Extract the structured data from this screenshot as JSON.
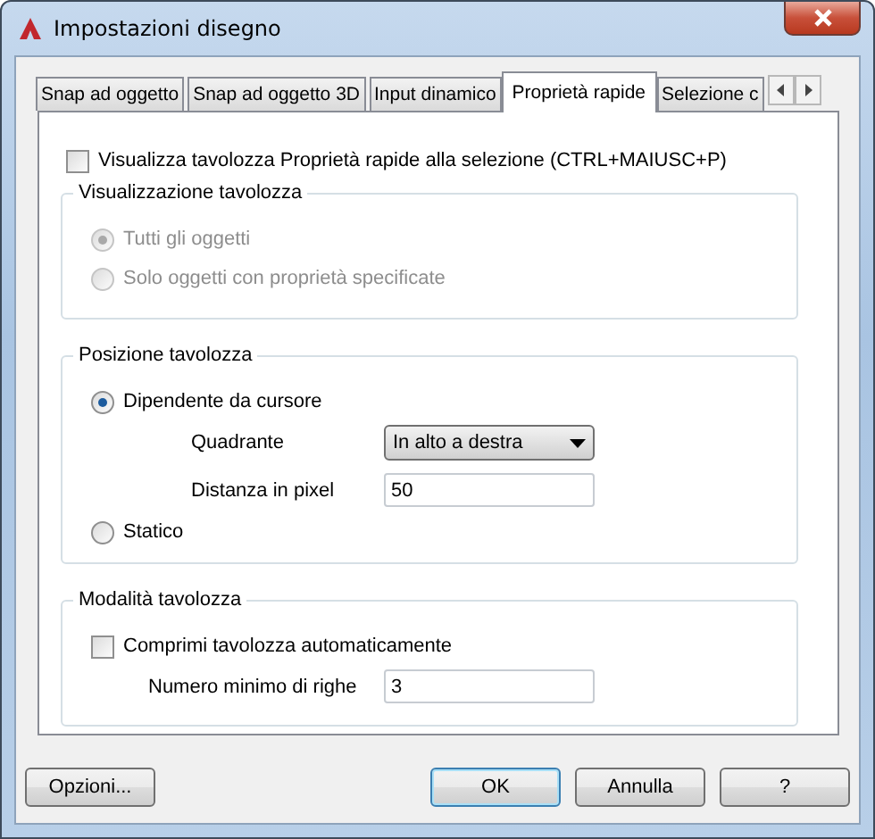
{
  "window": {
    "title": "Impostazioni disegno"
  },
  "tabs": [
    {
      "label": "Snap ad oggetto",
      "selected": false
    },
    {
      "label": "Snap ad oggetto 3D",
      "selected": false
    },
    {
      "label": "Input dinamico",
      "selected": false
    },
    {
      "label": "Proprietà rapide",
      "selected": true
    },
    {
      "label": "Selezione c",
      "selected": false
    }
  ],
  "show_palette": {
    "label": "Visualizza tavolozza Proprietà rapide alla selezione (CTRL+MAIUSC+P)",
    "checked": false
  },
  "display_group": {
    "title": "Visualizzazione tavolozza",
    "disabled": true,
    "options": [
      {
        "label": "Tutti gli oggetti",
        "selected": true
      },
      {
        "label": "Solo oggetti con proprietà specificate",
        "selected": false
      }
    ]
  },
  "position_group": {
    "title": "Posizione tavolozza",
    "options": [
      {
        "label": "Dipendente da cursore",
        "selected": true
      },
      {
        "label": "Statico",
        "selected": false
      }
    ],
    "quadrant": {
      "label": "Quadrante",
      "value": "In alto a destra"
    },
    "distance": {
      "label": "Distanza in pixel",
      "value": "50"
    }
  },
  "mode_group": {
    "title": "Modalità tavolozza",
    "collapse": {
      "label": "Comprimi tavolozza automaticamente",
      "checked": false
    },
    "min_rows": {
      "label": "Numero minimo di righe",
      "value": "3"
    }
  },
  "buttons": [
    {
      "label": "Opzioni...",
      "default": false
    },
    {
      "label": "OK",
      "default": true
    },
    {
      "label": "Annulla",
      "default": false
    },
    {
      "label": "?",
      "default": false
    }
  ]
}
